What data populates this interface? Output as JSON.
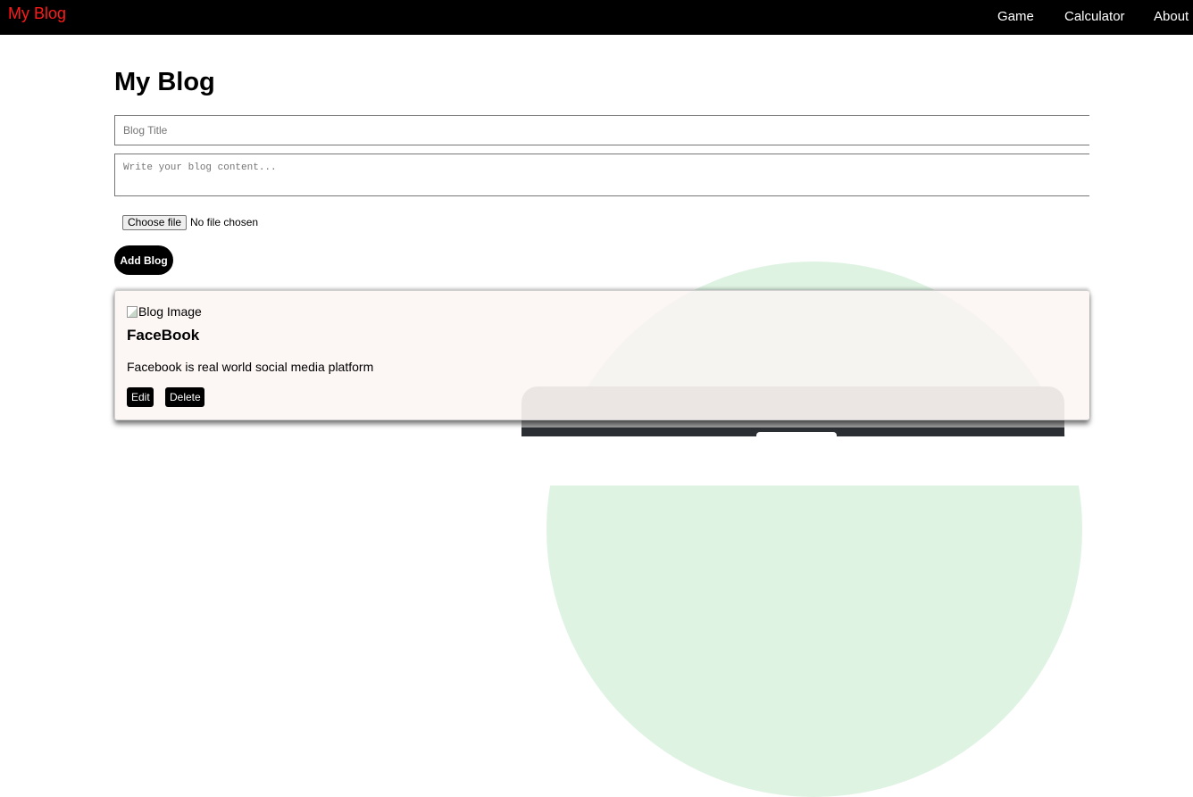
{
  "navbar": {
    "brand": "My Blog",
    "links": [
      "Game",
      "Calculator",
      "About"
    ]
  },
  "editor": {
    "heading": "My Blog",
    "title_placeholder": "Blog Title",
    "content_placeholder": "Write your blog content...",
    "file_button_label": "Choose file",
    "file_status": "No file chosen",
    "add_button_label": "Add Blog"
  },
  "posts": [
    {
      "image_alt": "Blog Image",
      "title": "FaceBook",
      "content": "Facebook is real world social media platform",
      "edit_label": "Edit",
      "delete_label": "Delete"
    }
  ],
  "colors": {
    "navbar_bg": "#000000",
    "brand": "#ff1a1a",
    "card_bg": "#fbf4f3",
    "button_bg": "#000000"
  },
  "icons": {
    "broken_image": "broken-image-icon"
  }
}
